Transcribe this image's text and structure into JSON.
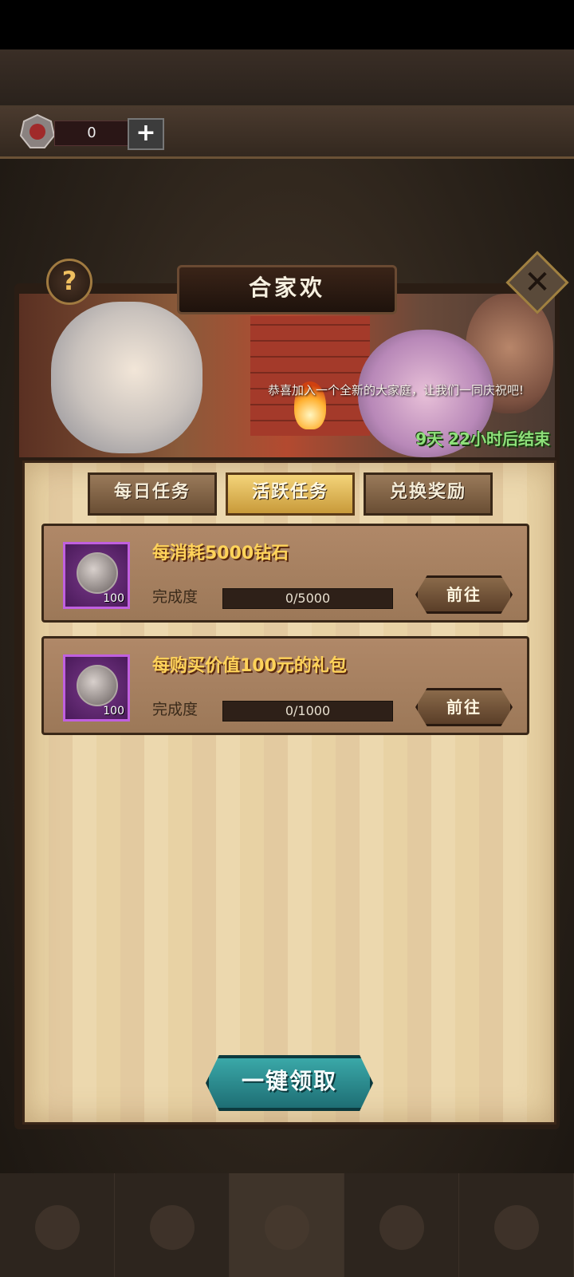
{
  "currency": {
    "value": "0",
    "plus_label": "+"
  },
  "dialog": {
    "title": "合家欢",
    "help_label": "?",
    "close_label": "✕",
    "banner_text": "恭喜加入一个全新的大家庭，让我们一同庆祝吧!",
    "countdown": "9天 22小时后结束",
    "tabs": [
      {
        "label": "每日任务",
        "active": false
      },
      {
        "label": "活跃任务",
        "active": true
      },
      {
        "label": "兑换奖励",
        "active": false
      }
    ],
    "tasks": [
      {
        "title": "每消耗5000钻石",
        "reward_count": "100",
        "progress_label": "完成度",
        "progress_text": "0/5000",
        "progress": 0,
        "go_label": "前往"
      },
      {
        "title": "每购买价值100元的礼包",
        "reward_count": "100",
        "progress_label": "完成度",
        "progress_text": "0/1000",
        "progress": 0,
        "go_label": "前往"
      }
    ],
    "claim_all_label": "一键领取"
  }
}
